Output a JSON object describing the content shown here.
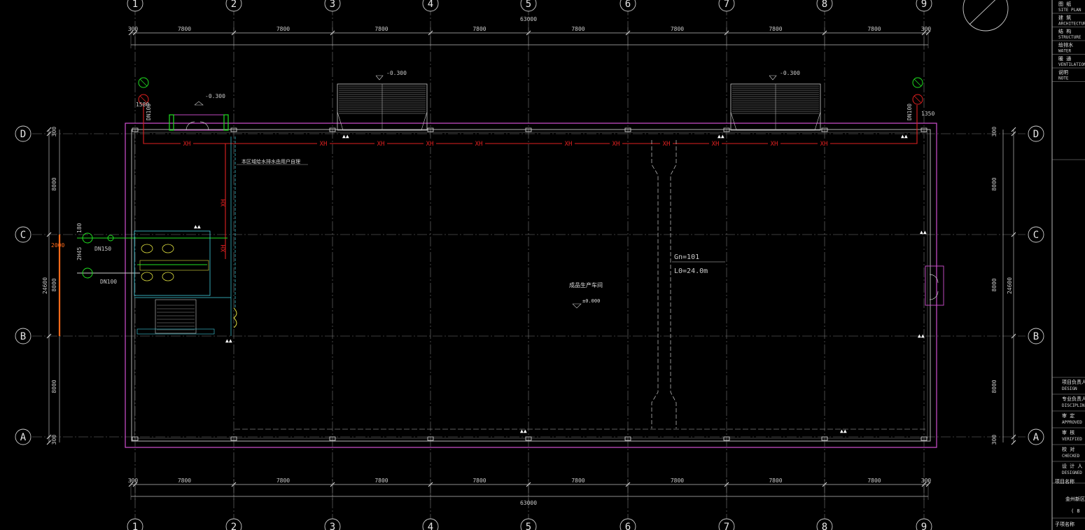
{
  "drawing": {
    "col_axes": [
      "1",
      "2",
      "3",
      "4",
      "5",
      "6",
      "7",
      "8",
      "9"
    ],
    "row_axes": [
      "D",
      "C",
      "B",
      "A"
    ],
    "top_dims": [
      "300",
      "7800",
      "7800",
      "7800",
      "7800",
      "7800",
      "7800",
      "7800",
      "7800",
      "300"
    ],
    "bottom_dims": [
      "300",
      "7800",
      "7800",
      "7800",
      "7800",
      "7800",
      "7800",
      "7800",
      "7800",
      "300"
    ],
    "total_dim": "63000",
    "side_dims": [
      "300",
      "8000",
      "8000",
      "8000",
      "300"
    ],
    "side_total": "24600",
    "left_hatch_label": "2000",
    "room_name": "成品生产车间",
    "floor_elevation": "±0.000",
    "roof_elevation_1": "-0.300",
    "roof_elevation_2": "-0.300",
    "entry_elevation": "-0.300",
    "pipe_labels": [
      "XH",
      "XH",
      "XH",
      "XH",
      "XH",
      "XH",
      "XH",
      "XH",
      "XH",
      "XH",
      "XH"
    ],
    "pipe_vert_label": "XH",
    "note_text": "本区域给水排水由用户自理",
    "fire_box_label_1": "Gn=101",
    "fire_box_label_2": "L0=24.0m",
    "dn150_label": "DN150",
    "dn100_label": "DN100",
    "dn100_vert_label_l": "DN100",
    "dn100_vert_label_r": "DN100",
    "left_pipe_dims": [
      "180",
      "2H45"
    ],
    "small_dim_l": "1580",
    "small_dim_r": "1350"
  },
  "title_block": {
    "rows": [
      {
        "cn": "图 纸",
        "en": "SITE PLAN"
      },
      {
        "cn": "建 筑",
        "en": "ARCHITECTURE"
      },
      {
        "cn": "结 构",
        "en": "STRUCTURE"
      },
      {
        "cn": "给排水",
        "en": "WATER"
      },
      {
        "cn": "暖 通",
        "en": "VENTILATION"
      },
      {
        "cn": "说明",
        "en": "NOTE"
      }
    ],
    "sign_rows": [
      {
        "cn": "项目负责人",
        "en": "DESIGN"
      },
      {
        "cn": "专业负责人",
        "en": "DISCIPLINE"
      },
      {
        "cn": "审 定",
        "en": "APPROVED"
      },
      {
        "cn": "审 核",
        "en": "VERIFIED"
      },
      {
        "cn": "校 对",
        "en": "CHECKED"
      },
      {
        "cn": "设 计 人",
        "en": "DESIGNED"
      }
    ],
    "project_label": "项目名称",
    "project_name": "金州新区",
    "project_sub": "( 8",
    "drawing_no_label": "子项名称"
  }
}
